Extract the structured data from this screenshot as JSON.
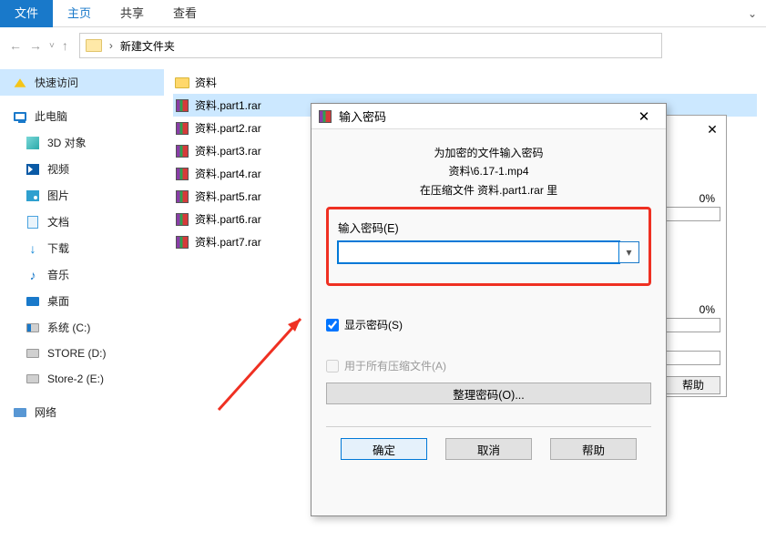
{
  "ribbon": {
    "file": "文件",
    "home": "主页",
    "share": "共享",
    "view": "查看"
  },
  "breadcrumb": {
    "folder": "新建文件夹"
  },
  "sidebar": {
    "quick": "快速访问",
    "pc": "此电脑",
    "objs": "3D 对象",
    "video": "视频",
    "pictures": "图片",
    "docs": "文档",
    "downloads": "下载",
    "music": "音乐",
    "desktop": "桌面",
    "sys": "系统 (C:)",
    "store": "STORE (D:)",
    "store2": "Store-2 (E:)",
    "network": "网络"
  },
  "files": {
    "folder": "资料",
    "part1": "资料.part1.rar",
    "part2": "资料.part2.rar",
    "part3": "资料.part3.rar",
    "part4": "资料.part4.rar",
    "part5": "资料.part5.rar",
    "part6": "资料.part6.rar",
    "part7": "资料.part7.rar"
  },
  "bg_dialog": {
    "close": "✕",
    "pct": "0%",
    "help": "帮助"
  },
  "dialog": {
    "title": "输入密码",
    "line1": "为加密的文件输入密码",
    "line2": "资料\\6.17-1.mp4",
    "line3": "在压缩文件 资料.part1.rar 里",
    "pw_label": "输入密码(E)",
    "pw_value": "",
    "show_pw": "显示密码(S)",
    "all_archives": "用于所有压缩文件(A)",
    "organize": "整理密码(O)...",
    "ok": "确定",
    "cancel": "取消",
    "help": "帮助",
    "close": "✕"
  }
}
